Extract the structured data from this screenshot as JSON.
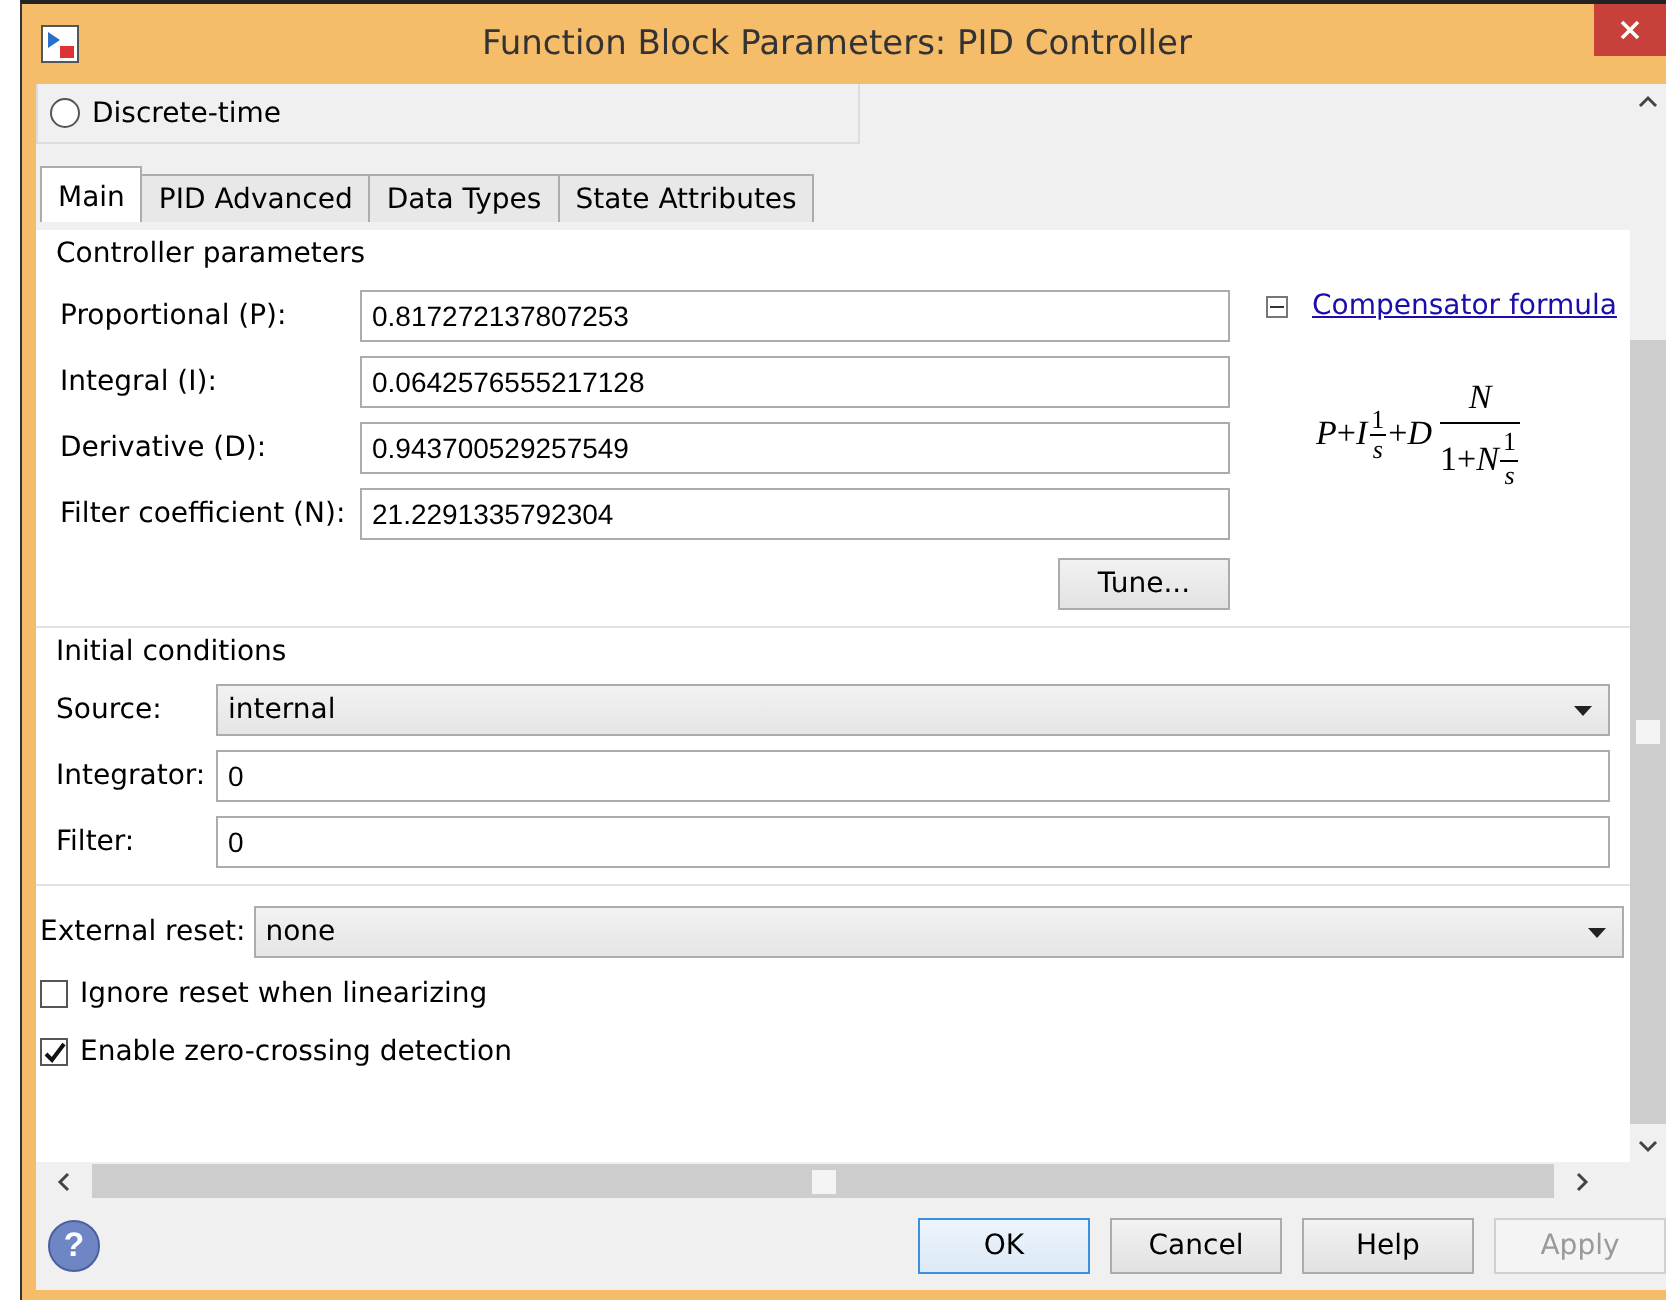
{
  "window": {
    "title": "Function Block Parameters: PID Controller"
  },
  "time_domain": {
    "label": "Discrete-time",
    "selected": false
  },
  "tabs": [
    {
      "label": "Main",
      "selected": true
    },
    {
      "label": "PID Advanced",
      "selected": false
    },
    {
      "label": "Data Types",
      "selected": false
    },
    {
      "label": "State Attributes",
      "selected": false
    }
  ],
  "controller_parameters": {
    "title": "Controller parameters",
    "fields": [
      {
        "label": "Proportional (P):",
        "value": "0.817272137807253"
      },
      {
        "label": "Integral (I):",
        "value": "0.0642576555217128"
      },
      {
        "label": "Derivative (D):",
        "value": "0.943700529257549"
      },
      {
        "label": "Filter coefficient (N):",
        "value": "21.2291335792304"
      }
    ],
    "tune_button": "Tune...",
    "compensator": {
      "label": "Compensator formula",
      "expanded": true
    },
    "formula": {
      "p": "P",
      "plus1": "+",
      "i": "I",
      "num1": "1",
      "den1": "s",
      "plus2": "+",
      "d": "D",
      "num": "N",
      "den_one": "1",
      "den_plus": "+",
      "den_n": "N",
      "num2": "1",
      "den2": "s"
    }
  },
  "initial_conditions": {
    "title": "Initial conditions",
    "source": {
      "label": "Source:",
      "value": "internal"
    },
    "fields": [
      {
        "label": "Integrator:",
        "value": "0"
      },
      {
        "label": "Filter:",
        "value": "0"
      }
    ]
  },
  "external_reset": {
    "label": "External reset:",
    "value": "none"
  },
  "checkboxes": [
    {
      "label": "Ignore reset when linearizing",
      "checked": false
    },
    {
      "label": "Enable zero-crossing detection",
      "checked": true
    }
  ],
  "help": "?",
  "buttons": [
    {
      "label": "OK",
      "focused": true,
      "disabled": false
    },
    {
      "label": "Cancel",
      "focused": false,
      "disabled": false
    },
    {
      "label": "Help",
      "focused": false,
      "disabled": false
    },
    {
      "label": "Apply",
      "focused": false,
      "disabled": true
    }
  ]
}
